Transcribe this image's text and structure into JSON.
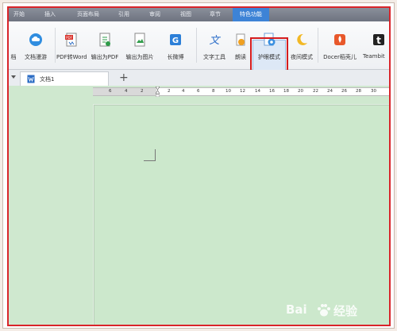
{
  "menu": {
    "tabs": [
      "开始",
      "插入",
      "页面布局",
      "引用",
      "审阅",
      "视图",
      "章节",
      "特色功能"
    ],
    "active_tab": "特色功能"
  },
  "toolbar": {
    "buttons": [
      {
        "label": "档",
        "icon": "doc-icon"
      },
      {
        "label": "文档漫游",
        "icon": "cloud-icon"
      },
      {
        "label": "PDF转Word",
        "icon": "pdf-to-word-icon"
      },
      {
        "label": "输出为PDF",
        "icon": "export-pdf-icon"
      },
      {
        "label": "输出为图片",
        "icon": "export-image-icon"
      },
      {
        "label": "长微博",
        "icon": "weibo-icon"
      },
      {
        "label": "文字工具",
        "icon": "text-tool-icon"
      },
      {
        "label": "朗读",
        "icon": "read-aloud-icon"
      },
      {
        "label": "护眼模式",
        "icon": "eye-protect-icon"
      },
      {
        "label": "夜间模式",
        "icon": "night-mode-icon"
      },
      {
        "label": "Docer稻壳儿",
        "icon": "docer-icon"
      },
      {
        "label": "Teambit",
        "icon": "teambition-icon"
      }
    ]
  },
  "doc_tab": {
    "title": "文档1",
    "plus": "+"
  },
  "ruler": {
    "numbers": [
      "6",
      "4",
      "2",
      "2",
      "4",
      "6",
      "8",
      "10",
      "12",
      "14",
      "16",
      "18",
      "20",
      "22",
      "24",
      "26",
      "28",
      "30"
    ]
  },
  "watermark": {
    "text_left": "Bai",
    "text_right": "经验"
  },
  "colors": {
    "active_tab": "#3d83d6",
    "page_bg": "#cce8cc",
    "highlight": "#d41c1f"
  }
}
